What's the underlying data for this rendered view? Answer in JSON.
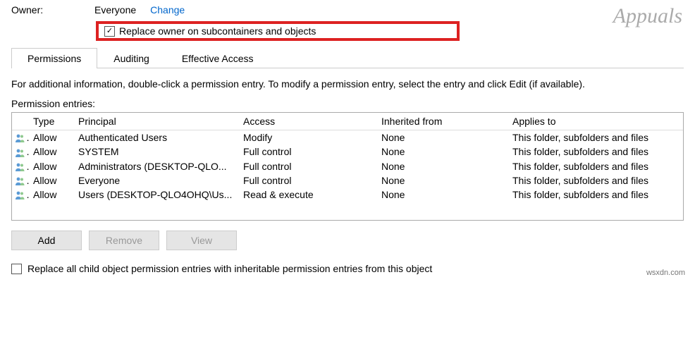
{
  "owner": {
    "label": "Owner:",
    "value": "Everyone",
    "change_link": "Change",
    "replace_checkbox_label": "Replace owner on subcontainers and objects",
    "replace_checked": true
  },
  "tabs": [
    {
      "label": "Permissions",
      "active": true
    },
    {
      "label": "Auditing",
      "active": false
    },
    {
      "label": "Effective Access",
      "active": false
    }
  ],
  "info_text": "For additional information, double-click a permission entry. To modify a permission entry, select the entry and click Edit (if available).",
  "entries_label": "Permission entries:",
  "columns": {
    "type": "Type",
    "principal": "Principal",
    "access": "Access",
    "inherited": "Inherited from",
    "applies": "Applies to"
  },
  "entries": [
    {
      "type": "Allow",
      "principal": "Authenticated Users",
      "access": "Modify",
      "inherited": "None",
      "applies": "This folder, subfolders and files"
    },
    {
      "type": "Allow",
      "principal": "SYSTEM",
      "access": "Full control",
      "inherited": "None",
      "applies": "This folder, subfolders and files"
    },
    {
      "type": "Allow",
      "principal": "Administrators (DESKTOP-QLO...",
      "access": "Full control",
      "inherited": "None",
      "applies": "This folder, subfolders and files"
    },
    {
      "type": "Allow",
      "principal": "Everyone",
      "access": "Full control",
      "inherited": "None",
      "applies": "This folder, subfolders and files"
    },
    {
      "type": "Allow",
      "principal": "Users (DESKTOP-QLO4OHQ\\Us...",
      "access": "Read & execute",
      "inherited": "None",
      "applies": "This folder, subfolders and files"
    }
  ],
  "buttons": {
    "add": "Add",
    "remove": "Remove",
    "view": "View"
  },
  "replace_child": {
    "label": "Replace all child object permission entries with inheritable permission entries from this object",
    "checked": false
  },
  "watermark": {
    "logo": "Appuals",
    "text": "wsxdn.com"
  }
}
